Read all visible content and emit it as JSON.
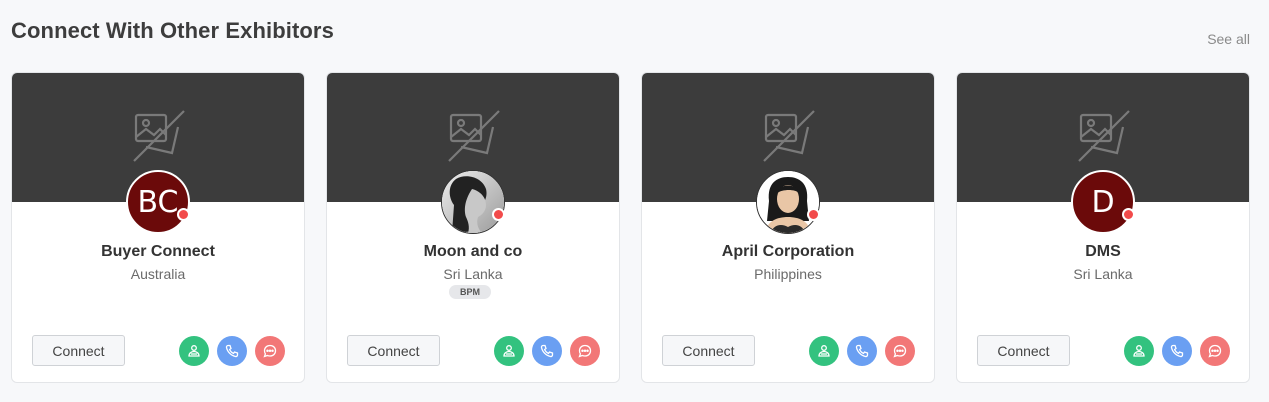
{
  "header": {
    "title": "Connect With Other Exhibitors",
    "see_all": "See all"
  },
  "cards": [
    {
      "name": "Buyer Connect",
      "country": "Australia",
      "avatar_initials": "BC",
      "avatar_type": "initials",
      "badge": "",
      "connect_label": "Connect"
    },
    {
      "name": "Moon and co",
      "country": "Sri Lanka",
      "avatar_initials": "",
      "avatar_type": "photo",
      "badge": "BPM",
      "connect_label": "Connect"
    },
    {
      "name": "April Corporation",
      "country": "Philippines",
      "avatar_initials": "",
      "avatar_type": "photo",
      "badge": "",
      "connect_label": "Connect"
    },
    {
      "name": "DMS",
      "country": "Sri Lanka",
      "avatar_initials": "D",
      "avatar_type": "initials",
      "badge": "",
      "connect_label": "Connect"
    }
  ],
  "icons": {
    "banner": "image-off-icon",
    "meet": "users-icon",
    "call": "phone-icon",
    "chat": "chat-icon"
  },
  "colors": {
    "banner": "#3c3c3c",
    "avatar_initials_bg": "#6b0a0a",
    "status_dot": "#f24b4b",
    "meet_button": "#33c27f",
    "call_button": "#6a9ff2",
    "chat_button": "#f27777"
  }
}
